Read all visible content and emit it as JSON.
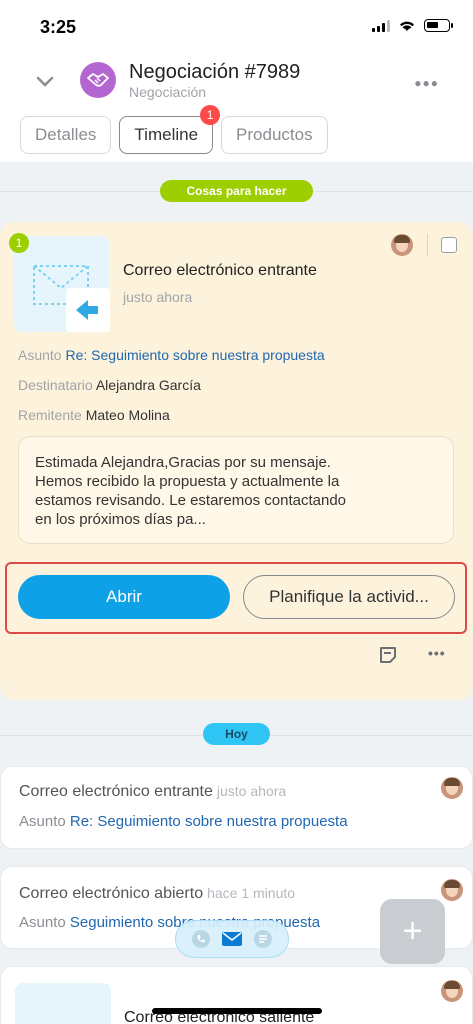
{
  "status": {
    "time": "3:25"
  },
  "header": {
    "title": "Negociación #7989",
    "subtitle": "Negociación",
    "tabs": [
      {
        "label": "Detalles"
      },
      {
        "label": "Timeline",
        "badge": "1",
        "active": true
      },
      {
        "label": "Productos"
      }
    ]
  },
  "todo_section": {
    "label": "Cosas para hacer"
  },
  "activity": {
    "badge": "1",
    "title": "Correo electrónico entrante",
    "time": "justo ahora",
    "subject_label": "Asunto",
    "subject": "Re: Seguimiento sobre nuestra propuesta",
    "recipient_label": "Destinatario",
    "recipient": "Alejandra García",
    "sender_label": "Remitente",
    "sender": "Mateo Molina",
    "message_lines": [
      "Estimada Alejandra,Gracias por su mensaje.",
      "Hemos recibido la propuesta y actualmente la",
      "estamos revisando. Le estaremos contactando",
      "en los próximos días pa..."
    ],
    "open_button": "Abrir",
    "plan_button": "Planifique la activid..."
  },
  "today_section": {
    "label": "Hoy"
  },
  "history": [
    {
      "title": "Correo electrónico entrante",
      "time": "justo ahora",
      "subject_label": "Asunto",
      "subject": "Re: Seguimiento sobre nuestra propuesta"
    },
    {
      "title": "Correo electrónico abierto",
      "time": "hace 1 minuto",
      "subject_label": "Asunto",
      "subject": "Seguimiento sobre nuestra propuesta"
    },
    {
      "title": "Correo electrónico saliente"
    }
  ],
  "colors": {
    "accent": "#0ea1e8",
    "todo_pill": "#9dcf00",
    "today_pill": "#2fc6f6",
    "highlight": "#d94b4b",
    "activity_bg": "#fdf3dd"
  },
  "icons": [
    "chevron-down-icon",
    "handshake-icon",
    "more-icon",
    "email-incoming-icon",
    "note-icon",
    "phone-icon",
    "mail-icon",
    "chat-icon",
    "plus-icon"
  ]
}
